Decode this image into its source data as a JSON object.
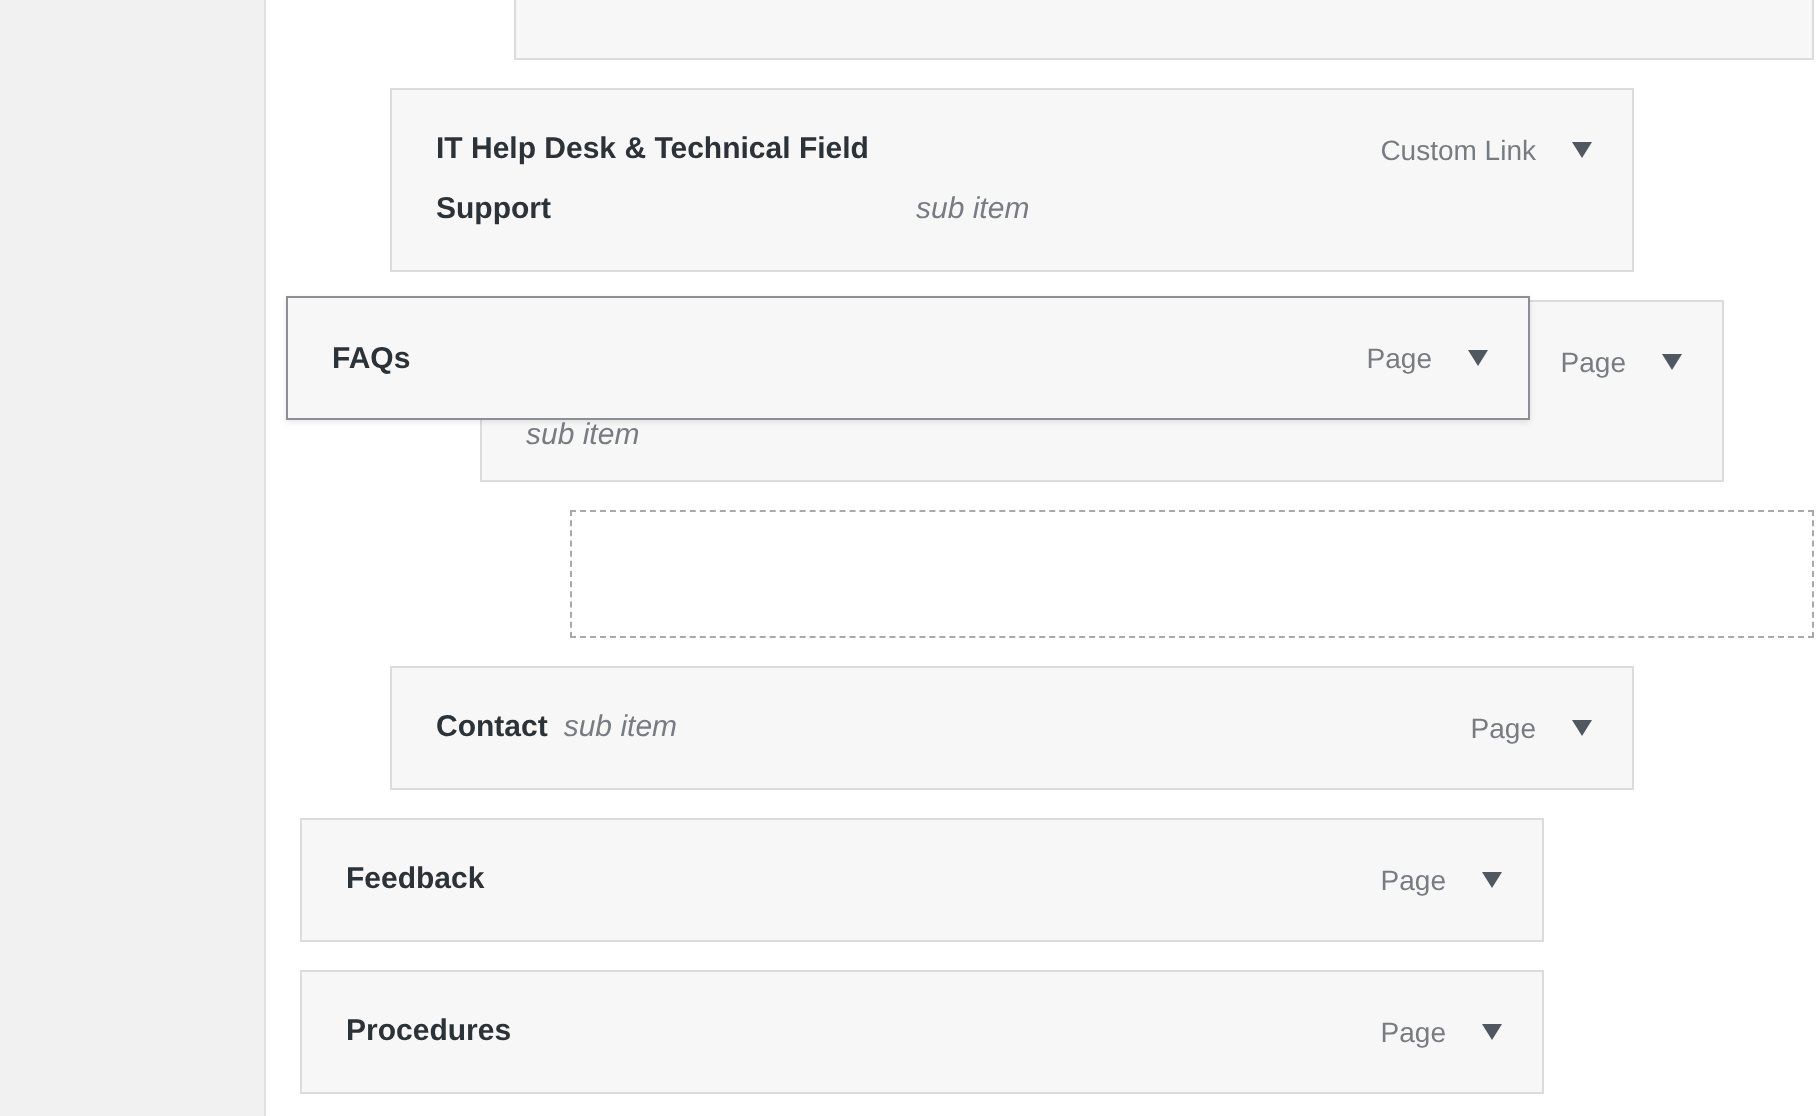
{
  "menu_items": [
    {
      "kind": "offscreen",
      "children": [
        {
          "kind": "offscreen",
          "children": [
            {
              "kind": "edge"
            }
          ]
        },
        {
          "kind": "item",
          "title": "IT Help Desk & Technical Field Support",
          "note": "sub item",
          "type": "Custom Link",
          "children": [
            {
              "kind": "covered",
              "note": "sub item",
              "type": "Page",
              "children": [
                {
                  "kind": "placeholder"
                }
              ]
            }
          ]
        },
        {
          "kind": "item",
          "title": "Contact",
          "note": "sub item",
          "type": "Page"
        }
      ]
    },
    {
      "kind": "item",
      "title": "Feedback",
      "type": "Page"
    },
    {
      "kind": "item",
      "title": "Procedures",
      "type": "Page"
    }
  ],
  "dragged_item": {
    "title": "FAQs",
    "type": "Page"
  }
}
